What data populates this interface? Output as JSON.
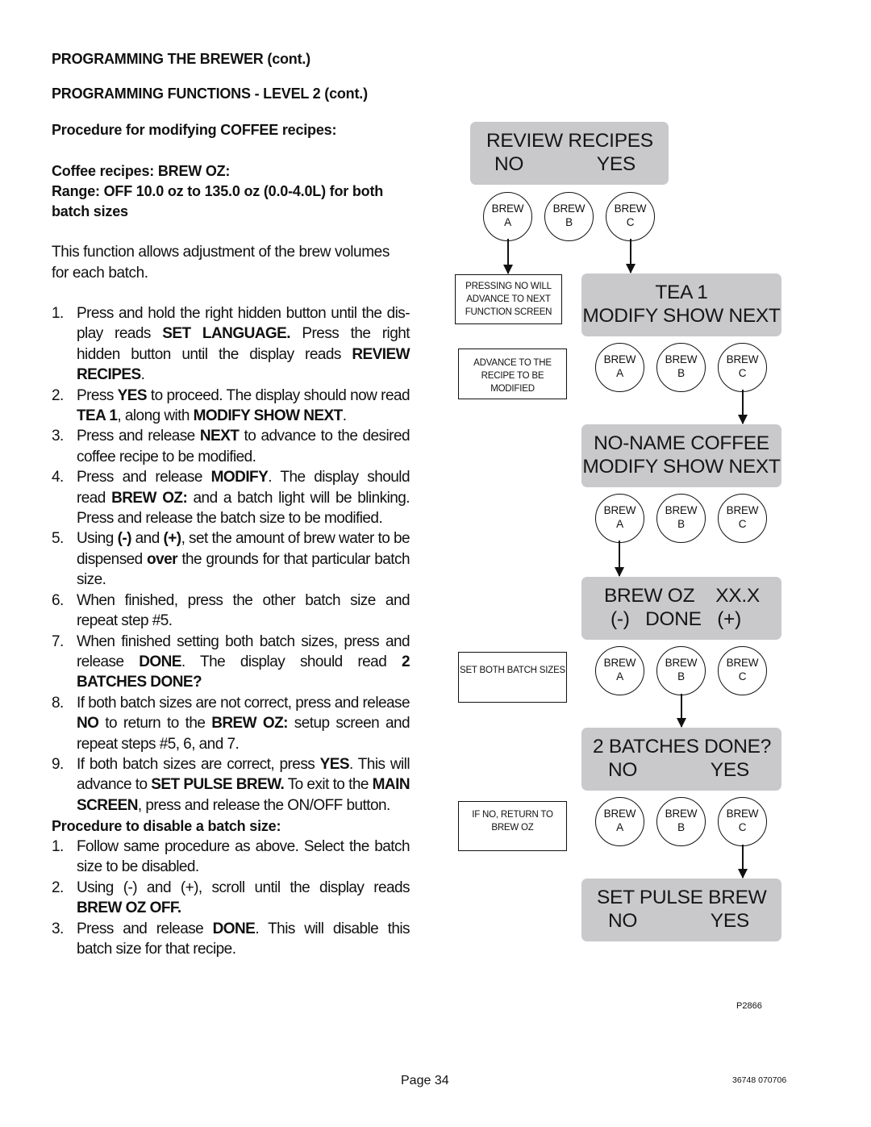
{
  "headings": {
    "section": "PROGRAMMING THE BREWER (cont.)",
    "subsection": "PROGRAMMING FUNCTIONS - LEVEL  2 (cont.)",
    "procedure": "Procedure for modifying COFFEE recipes:",
    "recipes": "Coffee recipes:  BREW OZ:",
    "range": "Range:  OFF 10.0 oz to 135.0 oz (0.0-4.0L) for both batch sizes"
  },
  "intro": "This function allows adjustment of the brew volumes for each batch.",
  "steps": [
    {
      "num": "1.",
      "parts": [
        [
          "Press and hold the right hidden button until the dis-play reads ",
          false
        ],
        [
          "SET LANGUAGE.",
          true
        ],
        [
          " Press the right hidden button until the display reads ",
          false
        ],
        [
          "REVIEW RECIPES",
          true
        ],
        [
          ".",
          false
        ]
      ]
    },
    {
      "num": "2.",
      "parts": [
        [
          "Press ",
          false
        ],
        [
          "YES",
          true
        ],
        [
          " to proceed. The display should now read ",
          false
        ],
        [
          "TEA 1",
          true
        ],
        [
          ", along with ",
          false
        ],
        [
          "MODIFY SHOW NEXT",
          true
        ],
        [
          ".",
          false
        ]
      ]
    },
    {
      "num": "3.",
      "parts": [
        [
          "Press and release ",
          false
        ],
        [
          "NEXT",
          true
        ],
        [
          " to advance to the desired coffee recipe to be modified.",
          false
        ]
      ]
    },
    {
      "num": "4.",
      "parts": [
        [
          "Press and release ",
          false
        ],
        [
          "MODIFY",
          true
        ],
        [
          ". The display should read ",
          false
        ],
        [
          "BREW OZ:",
          true
        ],
        [
          " and a batch light will be blinking. Press and release the batch size to be modified.",
          false
        ]
      ]
    },
    {
      "num": "5.",
      "parts": [
        [
          "Using ",
          false
        ],
        [
          "(-)",
          true
        ],
        [
          " and ",
          false
        ],
        [
          "(+)",
          true
        ],
        [
          ", set the amount of brew water to be dispensed ",
          false
        ],
        [
          "over",
          true
        ],
        [
          " the grounds for that particular batch size.",
          false
        ]
      ]
    },
    {
      "num": "6.",
      "parts": [
        [
          "When finished, press the other batch size and repeat step #5.",
          false
        ]
      ]
    },
    {
      "num": "7.",
      "parts": [
        [
          "When finished setting both batch sizes, press and release ",
          false
        ],
        [
          "DONE",
          true
        ],
        [
          ". The display should read ",
          false
        ],
        [
          "2 BATCHES DONE?",
          true
        ]
      ]
    },
    {
      "num": "8.",
      "parts": [
        [
          "If both batch sizes are not correct, press and release ",
          false
        ],
        [
          "NO",
          true
        ],
        [
          " to return to the ",
          false
        ],
        [
          "BREW OZ:",
          true
        ],
        [
          " setup screen and repeat steps #5, 6, and 7.",
          false
        ]
      ]
    },
    {
      "num": "9.",
      "parts": [
        [
          "If both batch sizes are correct, press ",
          false
        ],
        [
          "YES",
          true
        ],
        [
          ". This will advance to ",
          false
        ],
        [
          "SET PULSE BREW.",
          true
        ],
        [
          " To exit to the ",
          false
        ],
        [
          "MAIN SCREEN",
          true
        ],
        [
          ", press and release the ON/OFF button.",
          false
        ]
      ]
    }
  ],
  "disable": {
    "heading": "Procedure to disable a batch size:",
    "steps": [
      {
        "num": "1.",
        "parts": [
          [
            "Follow same procedure as above. Select the batch size to be disabled.",
            false
          ]
        ]
      },
      {
        "num": "2.",
        "parts": [
          [
            "Using (-) and (+), scroll until the display reads ",
            false
          ],
          [
            "BREW  OZ  OFF.",
            true
          ]
        ]
      },
      {
        "num": "3.",
        "parts": [
          [
            "Press and release ",
            false
          ],
          [
            "DONE",
            true
          ],
          [
            ". This will disable this batch size for that recipe.",
            false
          ]
        ]
      }
    ]
  },
  "diagram": {
    "screens": [
      {
        "line1": "REVIEW RECIPES",
        "line2": "NO              YES"
      },
      {
        "line1": "TEA 1",
        "line2": "MODIFY SHOW NEXT"
      },
      {
        "line1": "NO-NAME COFFEE",
        "line2": "MODIFY SHOW NEXT"
      },
      {
        "line1": "BREW OZ    XX.X",
        "line2": "(-)   DONE   (+)"
      },
      {
        "line1": "2 BATCHES DONE?",
        "line2": "NO              YES"
      },
      {
        "line1": "SET PULSE BREW",
        "line2": "NO              YES"
      }
    ],
    "button": {
      "top": "BREW",
      "a": "A",
      "b": "B",
      "c": "C"
    },
    "notes": [
      "PRESSING NO WILL ADVANCE TO NEXT FUNCTION SCREEN",
      "ADVANCE TO THE RECIPE TO BE MODIFIED",
      "SET BOTH BATCH SIZES",
      "IF NO, RETURN TO BREW OZ"
    ],
    "figure_id": "P2866"
  },
  "footer": {
    "page": "Page 34",
    "doc_number": "36748 070706"
  }
}
